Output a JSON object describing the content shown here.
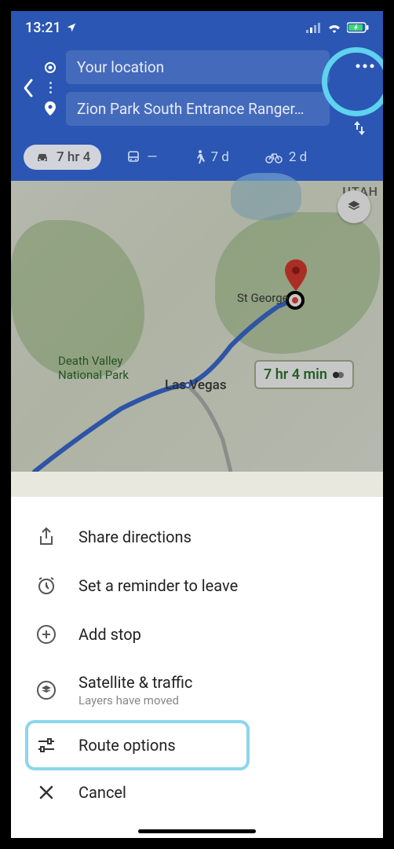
{
  "status": {
    "time": "13:21"
  },
  "header": {
    "origin_label": "Your location",
    "destination_label": "Zion Park South Entrance Ranger…"
  },
  "modes": {
    "car": "7 hr 4",
    "transit": "—",
    "walk": "7 d",
    "bike": "2 d"
  },
  "map": {
    "state_label": "UTAH",
    "city1": "St George",
    "city2": "Las Vegas",
    "poi1_line1": "Death Valley",
    "poi1_line2": "National Park",
    "duration_chip": "7 hr 4 min"
  },
  "sheet": {
    "share": "Share directions",
    "reminder": "Set a reminder to leave",
    "add_stop": "Add stop",
    "satellite": "Satellite & traffic",
    "satellite_sub": "Layers have moved",
    "route_options": "Route options",
    "cancel": "Cancel"
  }
}
